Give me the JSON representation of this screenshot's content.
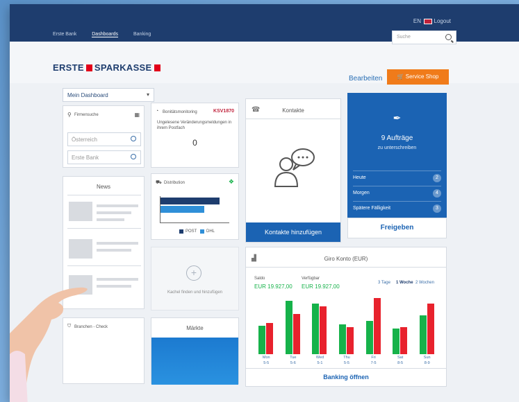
{
  "topnav": {
    "items": [
      "Erste Bank",
      "Dashboards",
      "Banking"
    ]
  },
  "lang": {
    "code": "EN"
  },
  "logout": "Logout",
  "search": {
    "placeholder": "Suche"
  },
  "logo": {
    "left": "ERSTE",
    "right": "SPARKASSE"
  },
  "actions": {
    "edit": "Bearbeiten",
    "shop": "Service Shop"
  },
  "dashboard_select": "Mein Dashboard",
  "firmensuche": {
    "title": "Firmensuche",
    "country": "Österreich",
    "bank": "Erste Bank"
  },
  "bonitaet": {
    "title": "Bonitätsmonitoring",
    "brand": "KSV1870",
    "text": "Ungelesene Veränderungsmeldungen in ihrem Postfach",
    "count": "0"
  },
  "kontakte": {
    "title": "Kontakte",
    "button": "Kontakte hinzufügen"
  },
  "auftraege": {
    "count_label": "9 Aufträge",
    "sub": "zu unterschreiben",
    "rows": [
      {
        "label": "Heute",
        "count": "2"
      },
      {
        "label": "Morgen",
        "count": "4"
      },
      {
        "label": "Spätere Fälligkeit",
        "count": "3"
      }
    ],
    "button": "Freigeben"
  },
  "news": {
    "title": "News"
  },
  "distribution": {
    "title": "Distribution",
    "legend": [
      "POST",
      "DHL"
    ]
  },
  "add_tile": {
    "label": "Kachel finden und hinzufügen"
  },
  "branchen": {
    "title": "Branchen - Check"
  },
  "maerkte": {
    "title": "Märkte"
  },
  "giro": {
    "title": "Giro Konto (EUR)",
    "saldo_label": "Saldo",
    "saldo_value": "EUR 19.927,00",
    "verf_label": "Verfügbar",
    "verf_value": "EUR 19.927,00",
    "ranges": [
      "3 Tage",
      "1 Woche",
      "2 Wochen"
    ],
    "button": "Banking öffnen",
    "days": [
      {
        "d": "Mon",
        "n": "5-5"
      },
      {
        "d": "Tue",
        "n": "5-6"
      },
      {
        "d": "Wed",
        "n": "5-1"
      },
      {
        "d": "Thu",
        "n": "5-5"
      },
      {
        "d": "Fri",
        "n": "7-5"
      },
      {
        "d": "Sat",
        "n": "8-5"
      },
      {
        "d": "Sun",
        "n": "8-9"
      }
    ]
  },
  "chart_data": {
    "type": "bar",
    "categories": [
      "Mon",
      "Tue",
      "Wed",
      "Thu",
      "Fri",
      "Sat",
      "Sun"
    ],
    "series": [
      {
        "values": [
          38,
          72,
          68,
          40,
          45,
          34,
          52
        ]
      },
      {
        "values": [
          42,
          54,
          64,
          36,
          75,
          36,
          68
        ]
      }
    ]
  },
  "colors": {
    "navy": "#1e3d6e",
    "accent_blue": "#1b63b3",
    "orange": "#f07b1a",
    "green": "#16b24a",
    "red": "#e8222d",
    "brand_red": "#e2001a"
  }
}
